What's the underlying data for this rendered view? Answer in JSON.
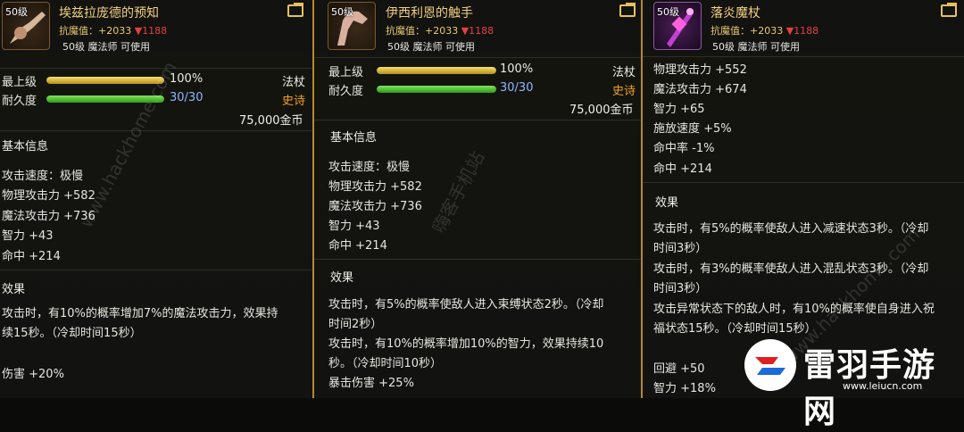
{
  "panels": [
    {
      "level": "50级",
      "name": "埃兹拉庞德的预知",
      "resist_label": "抗魔值：",
      "resist_up": "+2033",
      "resist_down": "▼1188",
      "requirement": "50级 魔法师 可使用",
      "grade_label": "最上级",
      "grade_pct": "100%",
      "grade_fill": 1.0,
      "durability_label": "耐久度",
      "durability_value": "30/30",
      "durability_fill": 1.0,
      "weapon_type": "法杖",
      "rarity": "史诗",
      "price": "75,000金币",
      "section_basic": "基本信息",
      "stats": [
        "攻击速度：极慢",
        "物理攻击力 +582",
        "魔法攻击力 +736",
        "智力 +43",
        "命中 +214"
      ],
      "section_effect": "效果",
      "effects": [
        "攻击时，有10%的概率增加7%的魔法攻击力，效果持",
        "续15秒。（冷却时间15秒）",
        "",
        "伤害 +20%"
      ]
    },
    {
      "level": "50级",
      "name": "伊西利恩的触手",
      "resist_label": "抗魔值：",
      "resist_up": "+2033",
      "resist_down": "▼1188",
      "requirement": "50级 魔法师 可使用",
      "grade_label": "最上级",
      "grade_pct": "100%",
      "grade_fill": 1.0,
      "durability_label": "耐久度",
      "durability_value": "30/30",
      "durability_fill": 1.0,
      "weapon_type": "法杖",
      "rarity": "史诗",
      "price": "75,000金币",
      "section_basic": "基本信息",
      "stats": [
        "攻击速度：极慢",
        "物理攻击力 +582",
        "魔法攻击力 +736",
        "智力 +43",
        "命中 +214"
      ],
      "section_effect": "效果",
      "effects": [
        "攻击时，有5%的概率使敌人进入束缚状态2秒。（冷却",
        "时间2秒）",
        "攻击时，有10%的概率增加10%的智力，效果持续10",
        "秒。（冷却时间10秒）",
        "暴击伤害 +25%"
      ]
    },
    {
      "level": "50级",
      "name": "落炎魔杖",
      "resist_label": "抗魔值：",
      "resist_up": "+2033",
      "resist_down": "▼1188",
      "requirement": "50级 魔法师 可使用",
      "stats": [
        "物理攻击力 +552",
        "魔法攻击力 +674",
        "智力 +65",
        "施放速度 +5%",
        "命中率 -1%",
        "命中 +214"
      ],
      "section_effect": "效果",
      "effects": [
        "攻击时，有5%的概率使敌人进入减速状态3秒。（冷却",
        "时间3秒）",
        "攻击时，有3%的概率使敌人进入混乱状态3秒。（冷却",
        "时间3秒）",
        "攻击异常状态下的敌人时，有10%的概率使自身进入祝",
        "福状态15秒。（冷却时间15秒）",
        "",
        "回避 +50",
        "智力 +18%"
      ]
    }
  ],
  "watermark": {
    "brand": "雷羽手游网",
    "url": "www.leiucn.com",
    "diag1": "www.hackhome.com",
    "diag2": "嗨客手机站",
    "diag3": "www.hackhome.com"
  },
  "colors": {
    "separator": "#b48a2a",
    "name": "#f2d080",
    "rarity_epic": "#f0a020",
    "durability_blue": "#8fb6ff"
  }
}
